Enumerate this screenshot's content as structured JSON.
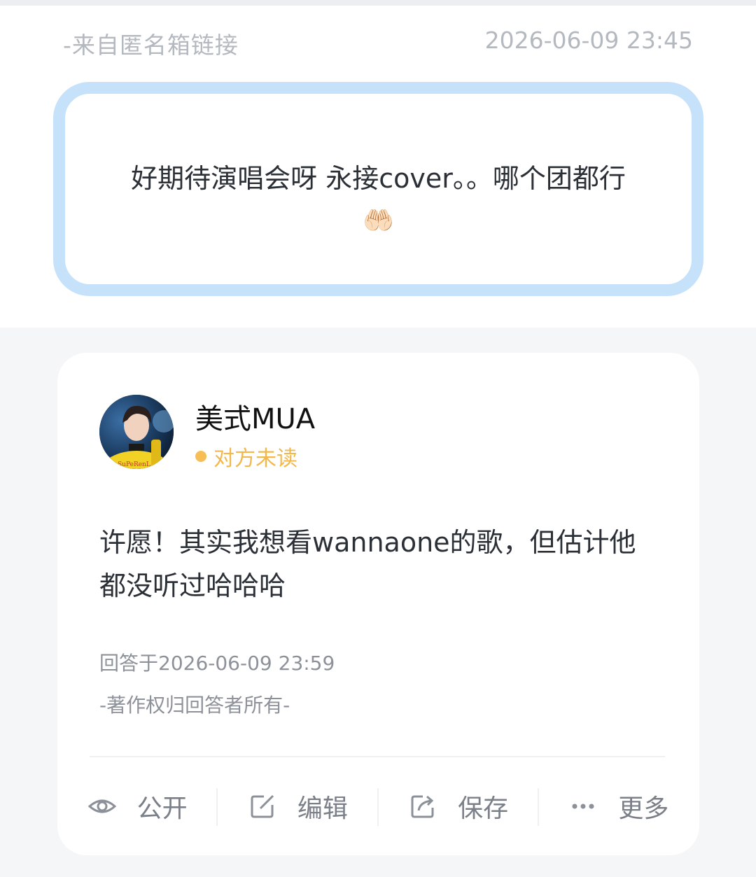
{
  "question": {
    "source": "-来自匿名箱链接",
    "time": "2026-06-09 23:45",
    "text": "好期待演唱会呀 永接cover。。哪个团都行",
    "emoji": "🤲🏻"
  },
  "answer": {
    "answerer_name": "美式MUA",
    "read_status": "对方未读",
    "text": "许愿！其实我想看wannaone的歌，但估计他都没听过哈哈哈",
    "time": "回答于2026-06-09 23:59",
    "copyright": "-著作权归回答者所有-",
    "avatar_shirt_text": "SuPeRenL"
  },
  "actions": [
    {
      "label": "公开",
      "icon": "eye-icon"
    },
    {
      "label": "编辑",
      "icon": "edit-icon"
    },
    {
      "label": "保存",
      "icon": "share-icon"
    },
    {
      "label": "更多",
      "icon": "more-icon"
    }
  ],
  "colors": {
    "question_border": "#c6e2fb",
    "status_accent": "#f3b84c"
  }
}
